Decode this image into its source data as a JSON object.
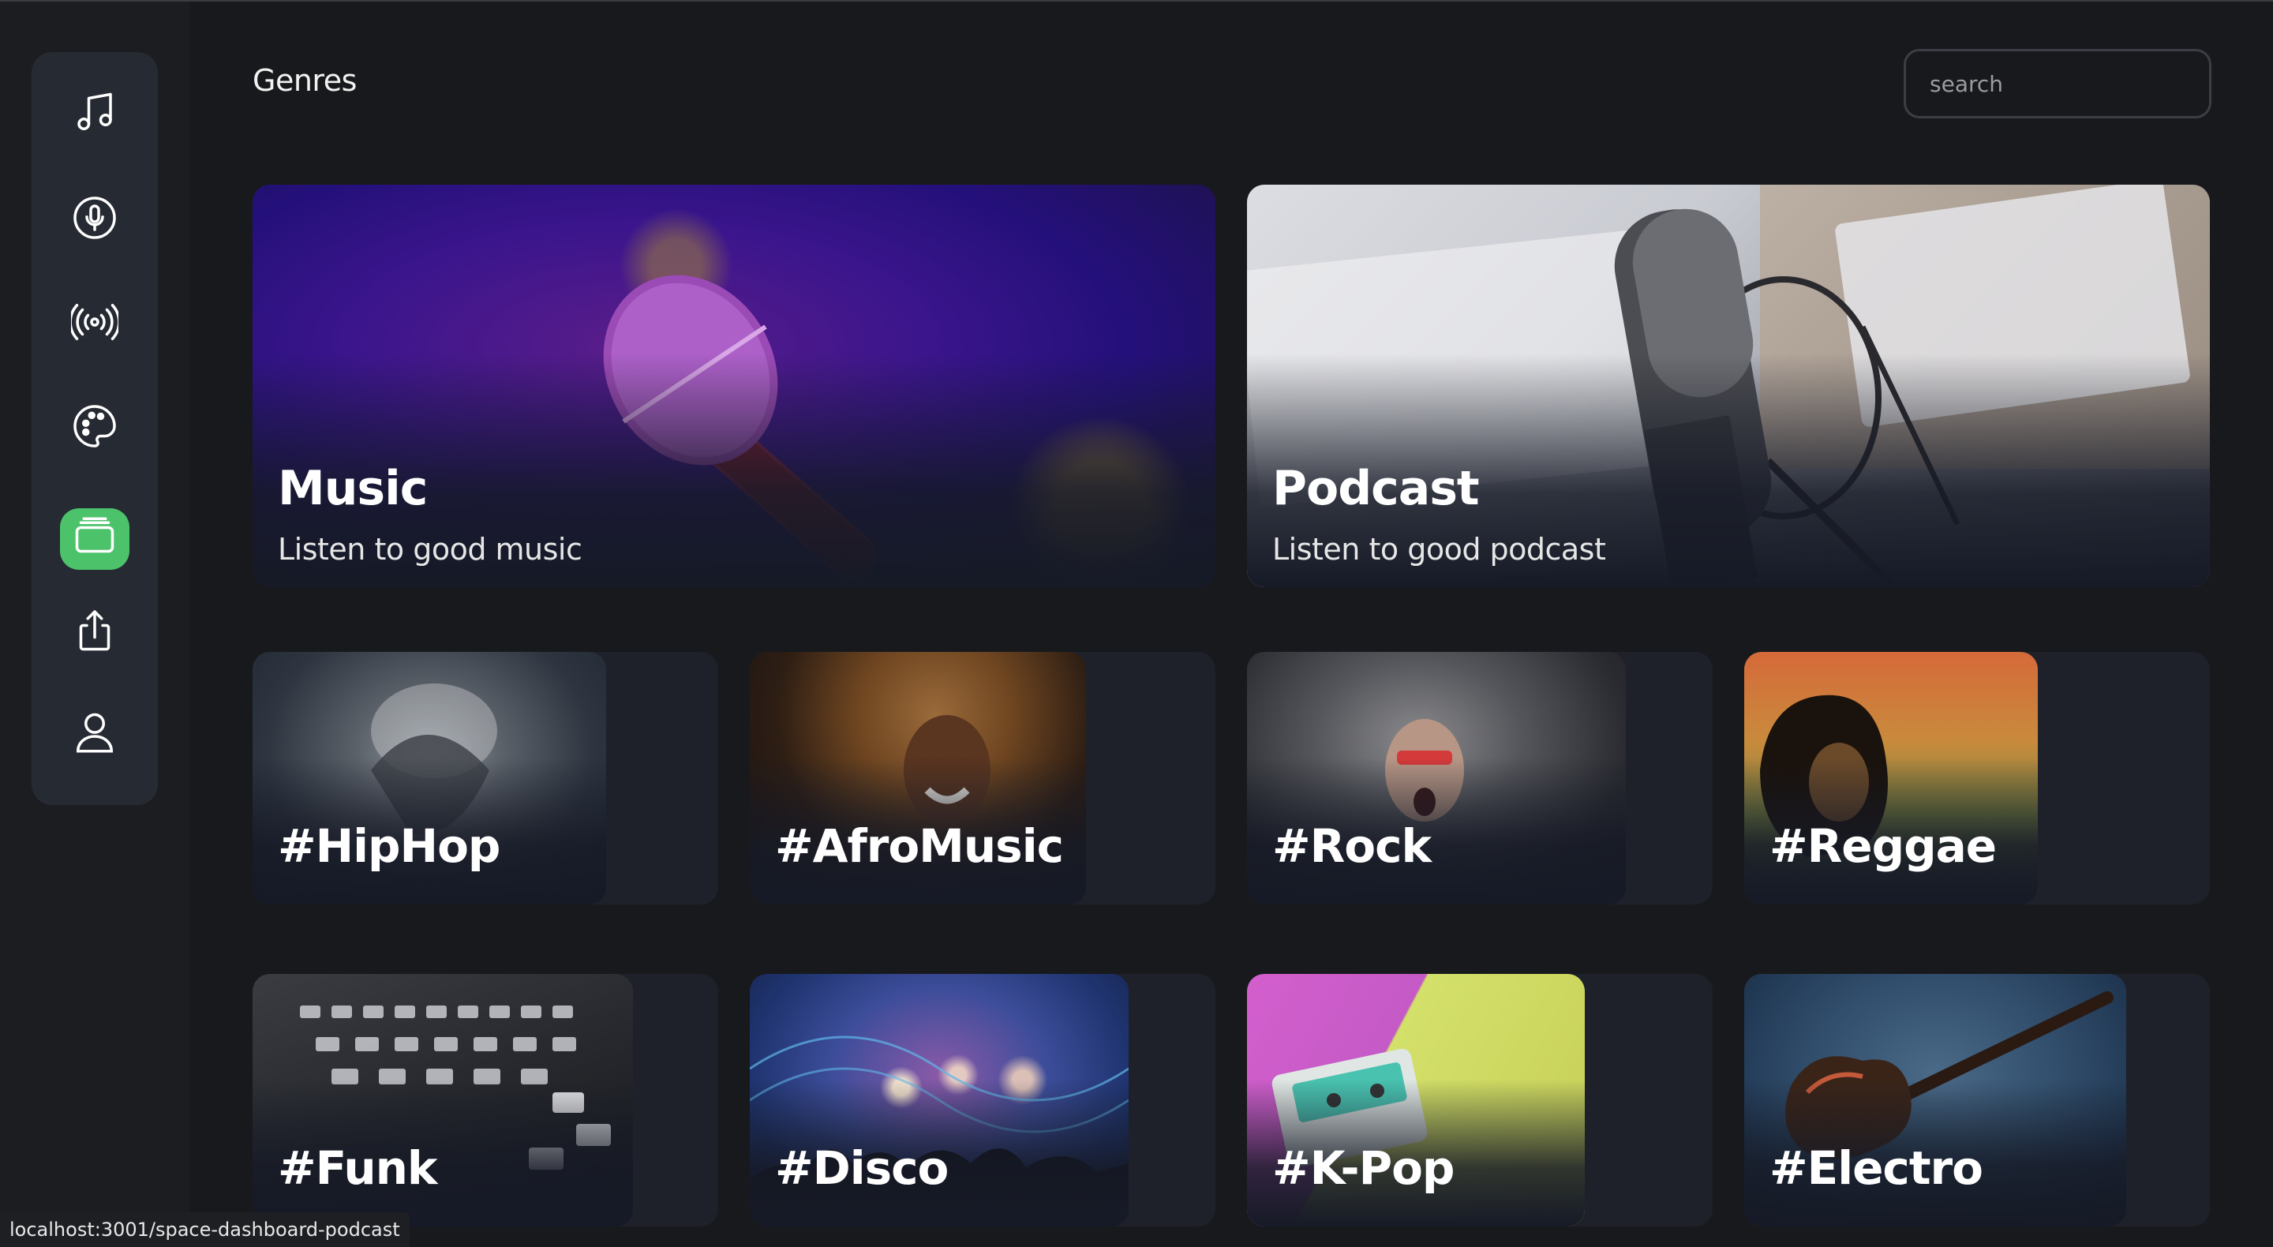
{
  "header": {
    "title": "Genres"
  },
  "search": {
    "placeholder": "search"
  },
  "sidebar": {
    "items": [
      {
        "icon": "music-note-icon"
      },
      {
        "icon": "microphone-icon"
      },
      {
        "icon": "broadcast-icon"
      },
      {
        "icon": "palette-icon"
      },
      {
        "icon": "genres-stack-icon",
        "active": true
      },
      {
        "icon": "share-icon"
      },
      {
        "icon": "user-icon"
      }
    ]
  },
  "featured": [
    {
      "title": "Music",
      "subtitle": "Listen to good music"
    },
    {
      "title": "Podcast",
      "subtitle": "Listen to good podcast"
    }
  ],
  "genres": [
    {
      "label": "#HipHop"
    },
    {
      "label": "#AfroMusic"
    },
    {
      "label": "#Rock"
    },
    {
      "label": "#Reggae"
    },
    {
      "label": "#Funk"
    },
    {
      "label": "#Disco"
    },
    {
      "label": "#K-Pop"
    },
    {
      "label": "#Electro"
    }
  ],
  "status_bar": {
    "url": "localhost:3001/space-dashboard-podcast"
  },
  "colors": {
    "background": "#18191c",
    "sidebar": "#262a33",
    "accent": "#4cc36a"
  }
}
